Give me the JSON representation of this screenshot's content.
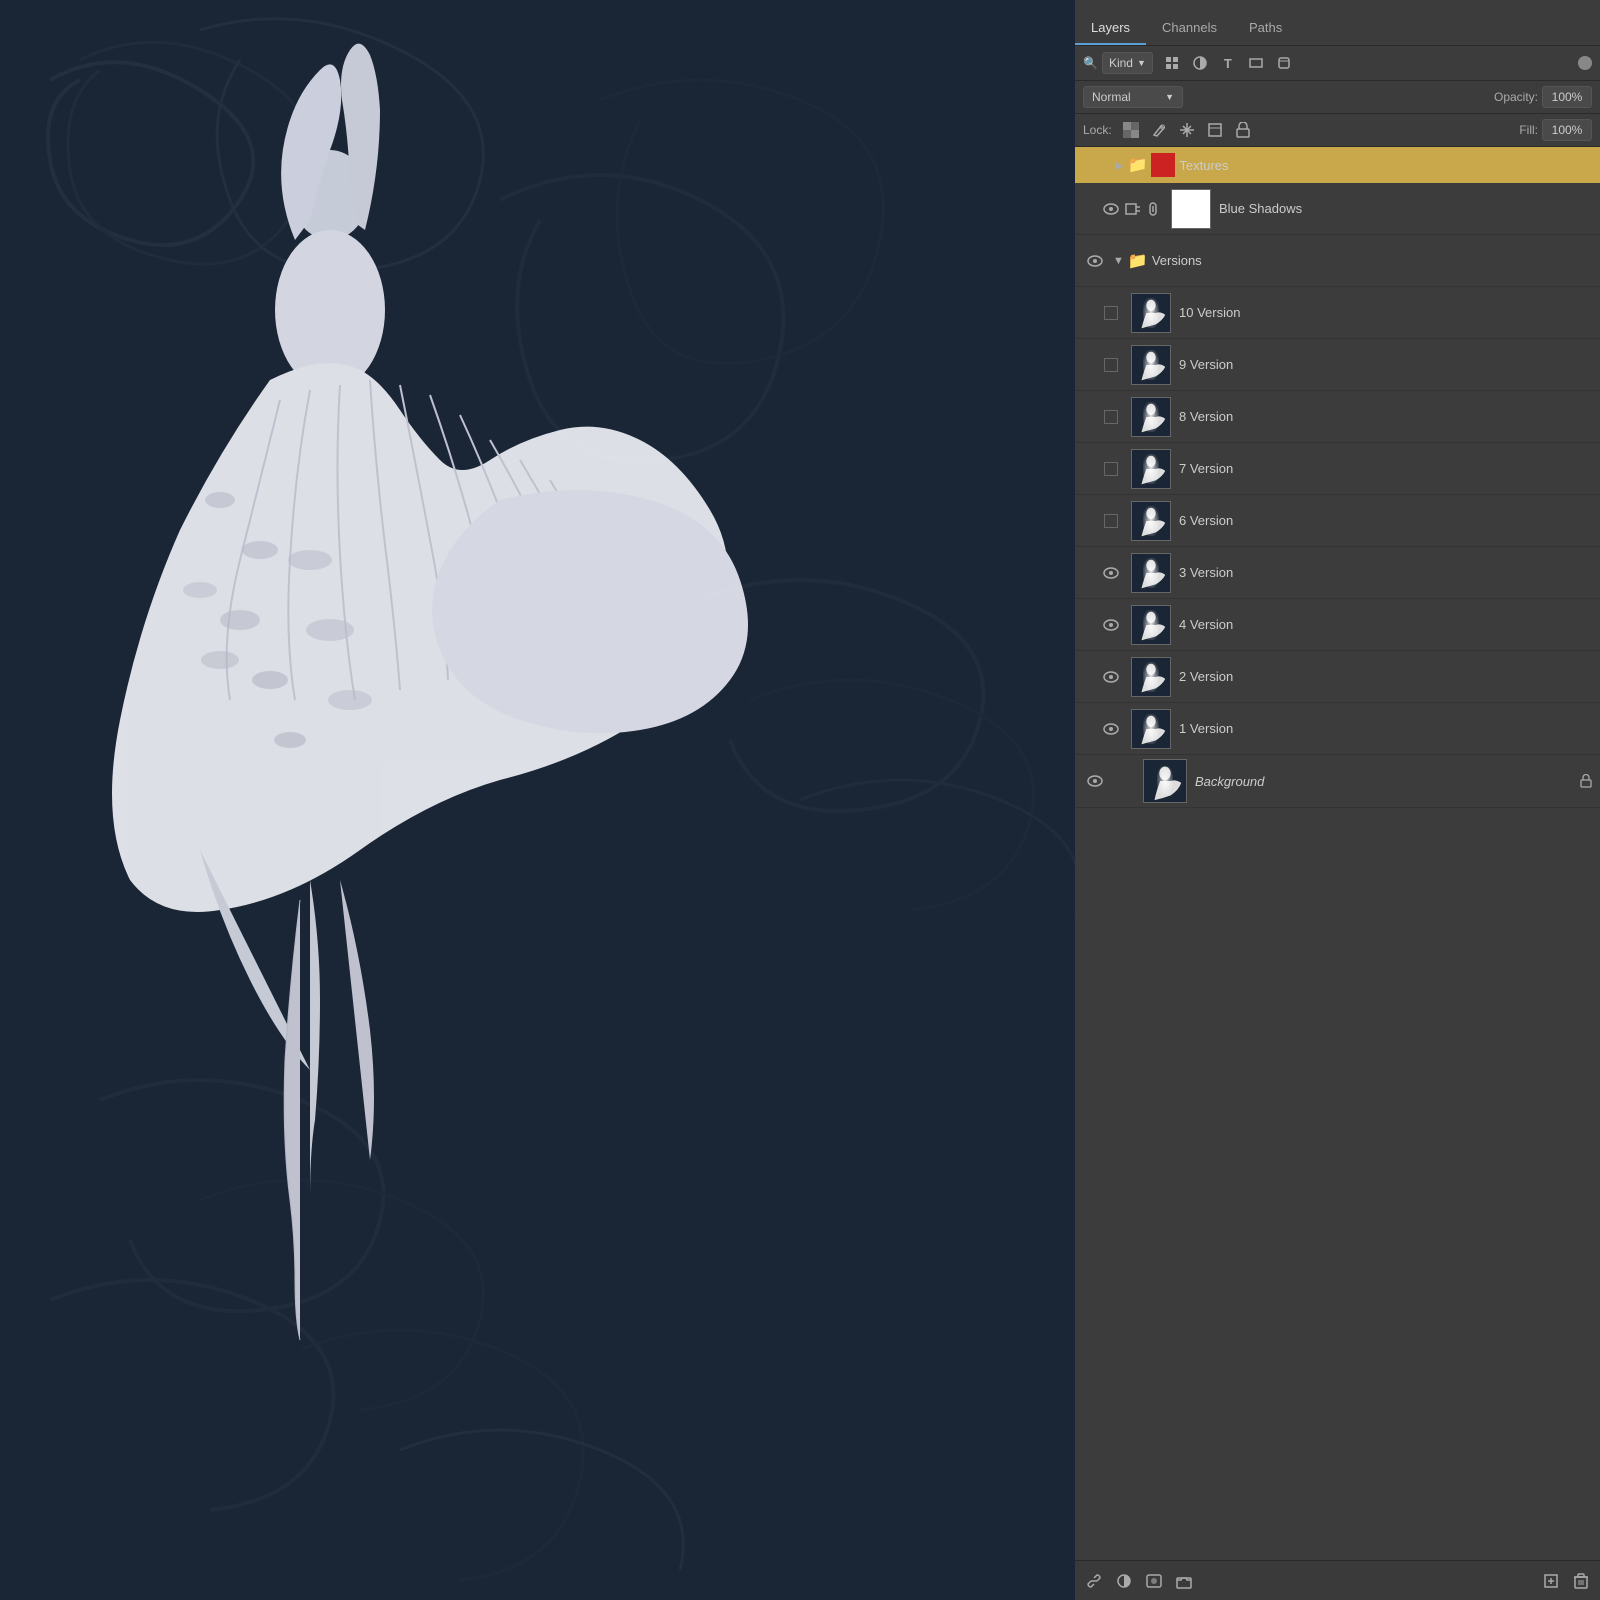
{
  "panel": {
    "tabs": [
      {
        "label": "Layers",
        "active": true
      },
      {
        "label": "Channels",
        "active": false
      },
      {
        "label": "Paths",
        "active": false
      }
    ],
    "filter": {
      "kind_label": "Kind",
      "search_placeholder": "Search"
    },
    "blend_mode": "Normal",
    "opacity_label": "Opacity:",
    "opacity_value": "100%",
    "lock_label": "Lock:",
    "fill_label": "Fill:",
    "fill_value": "100%"
  },
  "layers": [
    {
      "id": "textures-group",
      "type": "group",
      "name": "Textures",
      "visible": false,
      "collapsed": true,
      "indent": 0,
      "is_group_header": true
    },
    {
      "id": "blue-shadows",
      "type": "adjustment",
      "name": "Blue Shadows",
      "visible": true,
      "indent": 1,
      "has_white_thumb": true,
      "has_chain": true,
      "has_mask_icon": true
    },
    {
      "id": "versions-group",
      "type": "group",
      "name": "Versions",
      "visible": true,
      "indent": 0,
      "is_versions_group": true
    },
    {
      "id": "10-version",
      "type": "layer",
      "name": "10 Version",
      "visible": false,
      "indent": 1
    },
    {
      "id": "9-version",
      "type": "layer",
      "name": "9 Version",
      "visible": false,
      "indent": 1
    },
    {
      "id": "8-version",
      "type": "layer",
      "name": "8 Version",
      "visible": false,
      "indent": 1
    },
    {
      "id": "7-version",
      "type": "layer",
      "name": "7 Version",
      "visible": false,
      "indent": 1
    },
    {
      "id": "6-version",
      "type": "layer",
      "name": "6 Version",
      "visible": false,
      "indent": 1
    },
    {
      "id": "3-version",
      "type": "layer",
      "name": "3 Version",
      "visible": true,
      "indent": 1
    },
    {
      "id": "4-version",
      "type": "layer",
      "name": "4 Version",
      "visible": true,
      "indent": 1
    },
    {
      "id": "2-version",
      "type": "layer",
      "name": "2 Version",
      "visible": true,
      "indent": 1
    },
    {
      "id": "1-version",
      "type": "layer",
      "name": "1 Version",
      "visible": true,
      "indent": 1
    },
    {
      "id": "background",
      "type": "layer",
      "name": "Background",
      "visible": true,
      "indent": 0,
      "is_background": true,
      "italic_name": true
    }
  ],
  "toolbar": {
    "link_btn": "🔗",
    "new_group_btn": "📁",
    "adjustment_btn": "◐",
    "trash_btn": "🗑",
    "new_layer_btn": "+"
  }
}
